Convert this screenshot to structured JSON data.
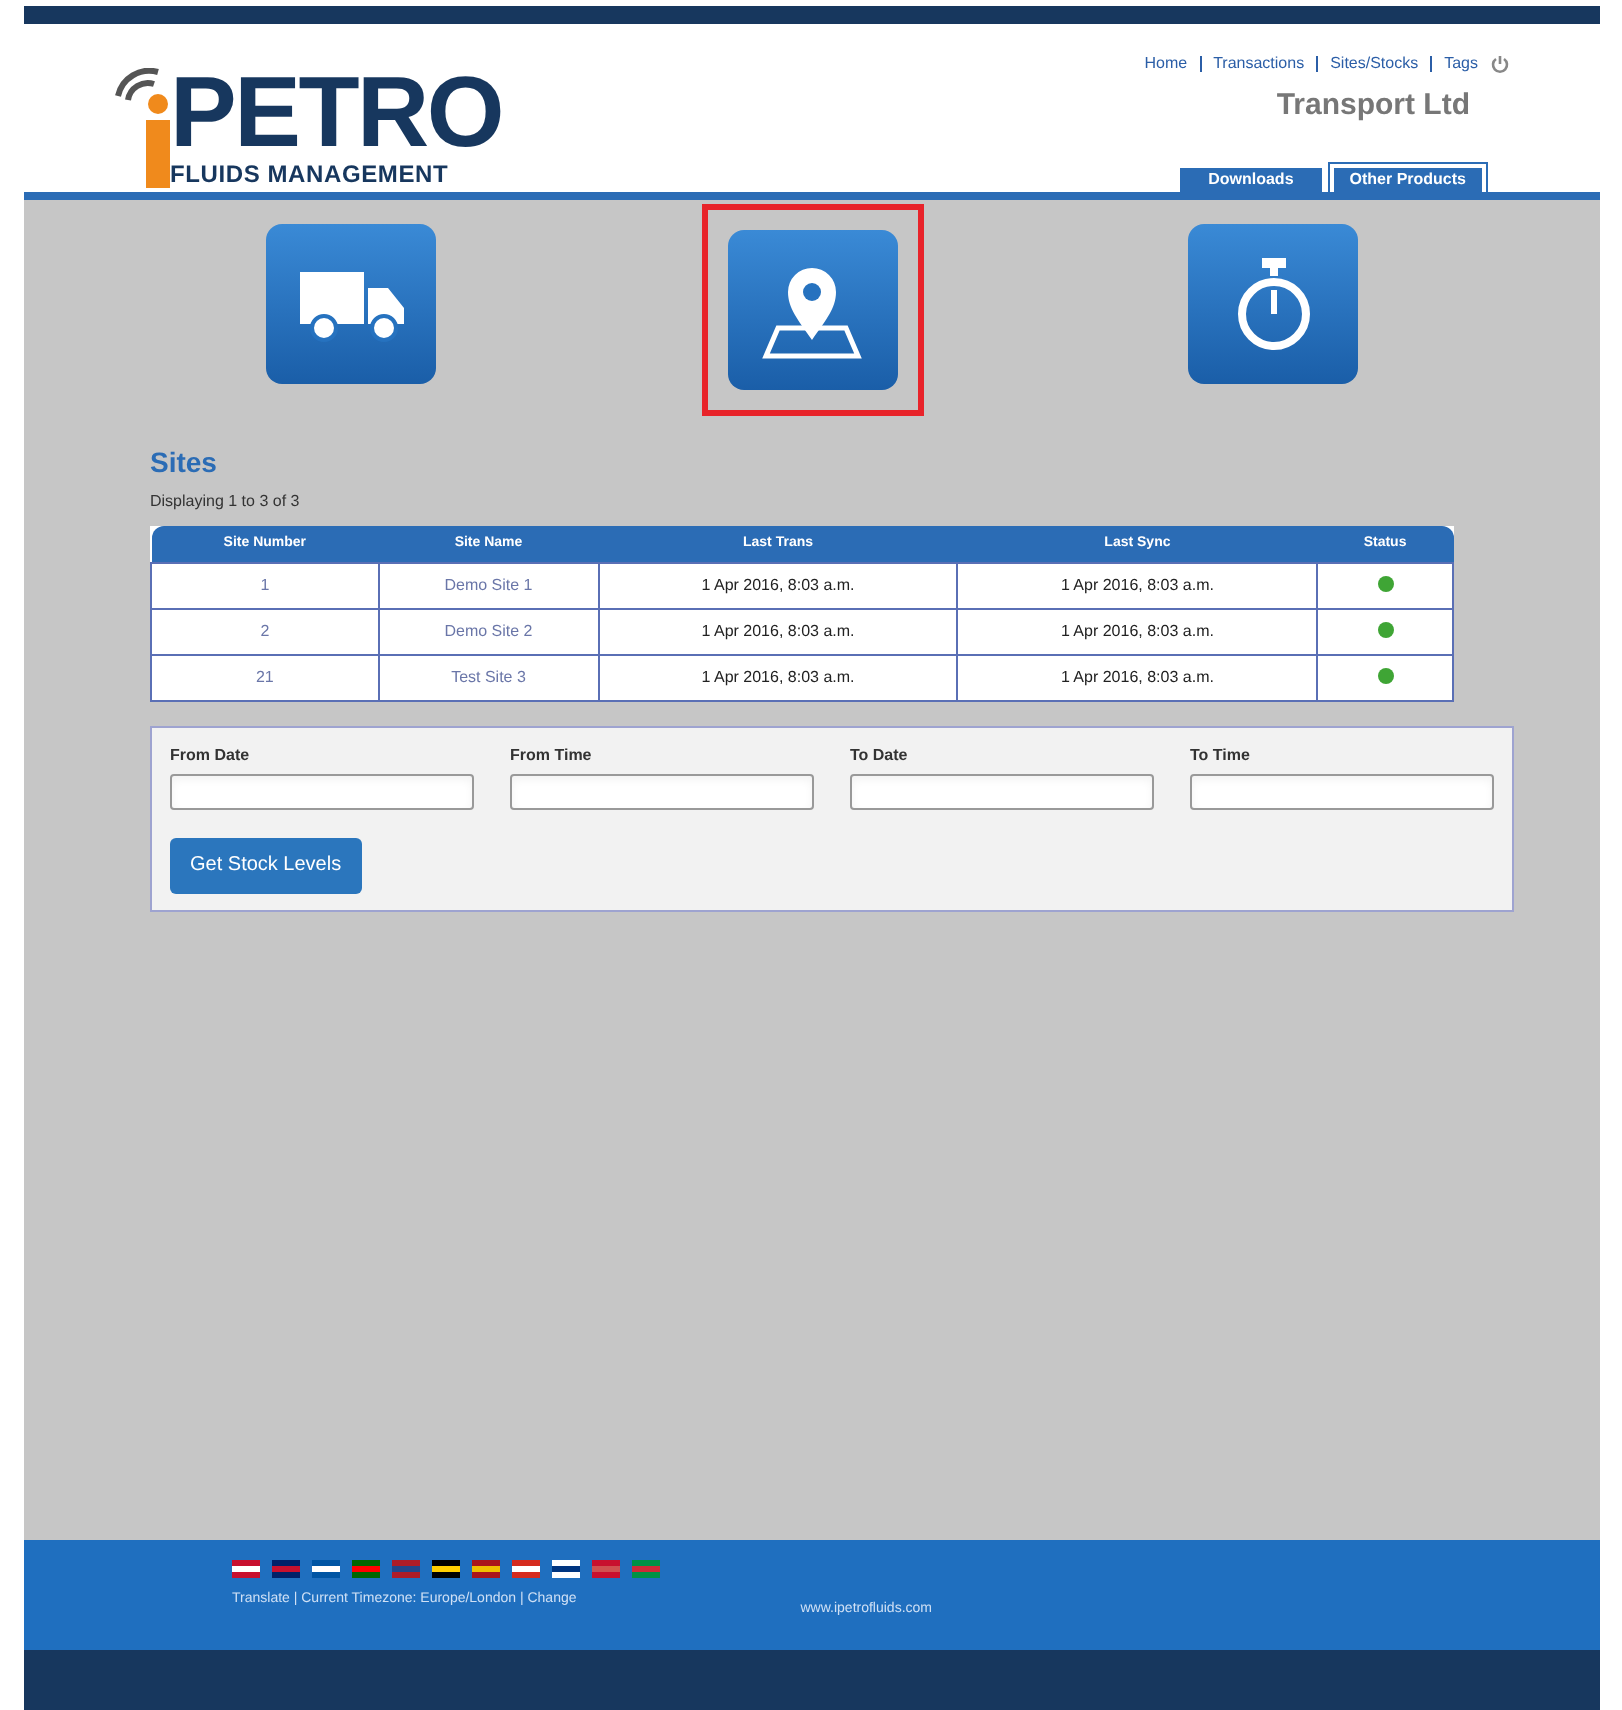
{
  "header": {
    "logo_text": "PETRO",
    "logo_subtitle": "FLUIDS MANAGEMENT",
    "nav": [
      "Home",
      "Transactions",
      "Sites/Stocks",
      "Tags"
    ],
    "company": "Transport Ltd",
    "tabs": [
      {
        "label": "Downloads",
        "selected": false
      },
      {
        "label": "Other Products",
        "selected": true
      }
    ]
  },
  "tiles": [
    {
      "kind": "truck",
      "selected": false
    },
    {
      "kind": "map",
      "selected": true
    },
    {
      "kind": "stopwatch",
      "selected": false
    }
  ],
  "sites": {
    "title": "Sites",
    "summary": "Displaying 1 to 3 of 3",
    "columns": [
      "Site Number",
      "Site Name",
      "Last Trans",
      "Last Sync",
      "Status"
    ],
    "rows": [
      {
        "number": "1",
        "name": "Demo Site 1",
        "last_trans": "1 Apr 2016, 8:03 a.m.",
        "last_sync": "1 Apr 2016, 8:03 a.m.",
        "color": "#3fa535"
      },
      {
        "number": "2",
        "name": "Demo Site 2",
        "last_trans": "1 Apr 2016, 8:03 a.m.",
        "last_sync": "1 Apr 2016, 8:03 a.m.",
        "color": "#3fa535"
      },
      {
        "number": "21",
        "name": "Test Site 3",
        "last_trans": "1 Apr 2016, 8:03 a.m.",
        "last_sync": "1 Apr 2016, 8:03 a.m.",
        "color": "#3fa535"
      }
    ]
  },
  "filter": {
    "fields": [
      {
        "label": "From Date"
      },
      {
        "label": "From Time"
      },
      {
        "label": "To Date"
      },
      {
        "label": "To Time"
      }
    ],
    "button": "Get Stock Levels"
  },
  "footer": {
    "links": "Translate | Current Timezone: Europe/London | Change",
    "website": "www.ipetrofluids.com"
  }
}
